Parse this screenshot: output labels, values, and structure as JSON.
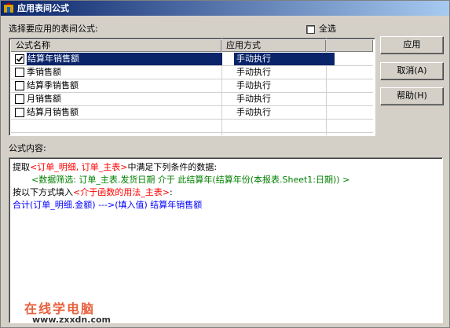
{
  "window": {
    "title": "应用表间公式"
  },
  "select_label": "选择要应用的表间公式:",
  "select_all": {
    "label": "全选",
    "checked": false
  },
  "list": {
    "columns": [
      "公式名称",
      "应用方式"
    ],
    "rows": [
      {
        "name": "结算年销售额",
        "mode": "手动执行",
        "checked": true,
        "selected": true
      },
      {
        "name": "季销售额",
        "mode": "手动执行",
        "checked": false,
        "selected": false
      },
      {
        "name": "结算季销售额",
        "mode": "手动执行",
        "checked": false,
        "selected": false
      },
      {
        "name": "月销售额",
        "mode": "手动执行",
        "checked": false,
        "selected": false
      },
      {
        "name": "结算月销售额",
        "mode": "手动执行",
        "checked": false,
        "selected": false
      }
    ]
  },
  "buttons": {
    "apply": "应用",
    "cancel": "取消(A)",
    "help": "帮助(H)"
  },
  "formula": {
    "label": "公式内容:",
    "line1": {
      "a": "提取",
      "b": "<订单_明细, 订单_主表>",
      "c": "中满足下列条件的数据:"
    },
    "line2": "<数据筛选: 订单_主表.发货日期 介于 此结算年(结算年份(本报表.Sheet1:日期)) >",
    "line3": {
      "a": "按以下方式填入",
      "b": "<介于函数的用法_主表>",
      "c": ":"
    },
    "line4": "合计(订单_明细.金额)  --->(填入值)  结算年销售额"
  },
  "watermark": {
    "brand": "在线学电脑",
    "url": "www.zxxdn.com"
  },
  "colors": {
    "titlebar_start": "#0a246a",
    "titlebar_end": "#a6caf0",
    "selection": "#0a246a",
    "red": "#ff0000",
    "green": "#008000",
    "blue": "#0000ff"
  }
}
